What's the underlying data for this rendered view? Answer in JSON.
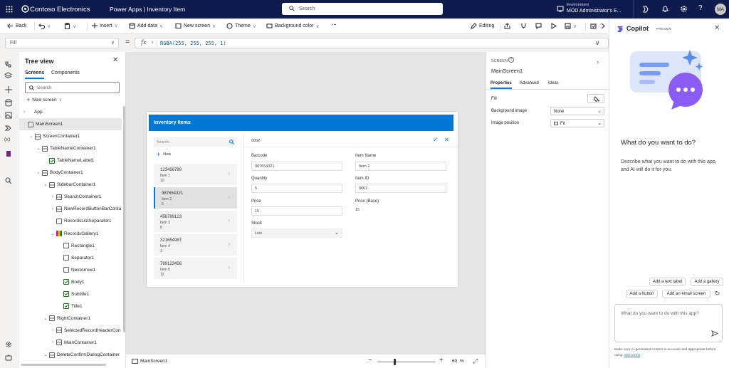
{
  "topbar": {
    "app": "Contoso Electronics",
    "breadcrumb": "Power Apps | Inventory Item",
    "search_placeholder": "Search",
    "env_label": "Environment",
    "env_name": "MOD Administrator's E...",
    "avatar": "MA"
  },
  "command": {
    "back": "Back",
    "insert": "Insert",
    "add_data": "Add data",
    "new_screen": "New screen",
    "theme": "Theme",
    "bg_color": "Background color",
    "more": "···",
    "editing": "Editing"
  },
  "formula": {
    "property": "Fill",
    "fx": "fx",
    "value": "RGBA(255, 255, 255, 1)"
  },
  "tree": {
    "title": "Tree view",
    "tab_screens": "Screens",
    "tab_components": "Components",
    "search_placeholder": "Search",
    "new_screen": "New screen",
    "items": [
      "App",
      "MainScreen1",
      "ScreenContainer1",
      "TableNameContainer1",
      "TableNameLabel1",
      "BodyContainer1",
      "SidebarContainer1",
      "SearchContainer1",
      "NewRecordButtonBarConta",
      "RecordsListSeparator1",
      "RecordsGallery1",
      "Rectangle1",
      "Separator1",
      "NextArrow1",
      "Body1",
      "Subtitle1",
      "Title1",
      "RightContainer1",
      "SelectedRecordHeaderCon",
      "MainContainer1",
      "DeleteConfirmDialogContainer"
    ]
  },
  "app": {
    "header": "Inventory Items",
    "search_placeholder": "Search",
    "new": "New",
    "selected_value": "0002",
    "gallery": [
      {
        "title": "123456789",
        "subtitle": "Item 1",
        "body": "10"
      },
      {
        "title": "987654321",
        "subtitle": "Item 2",
        "body": "5"
      },
      {
        "title": "456789123",
        "subtitle": "Item 3",
        "body": "8"
      },
      {
        "title": "321654987",
        "subtitle": "Item 4",
        "body": "3"
      },
      {
        "title": "789123456",
        "subtitle": "Item 5",
        "body": "12"
      }
    ],
    "form": {
      "barcode_label": "Barcode",
      "barcode": "987654321",
      "item_name_label": "Item Name",
      "item_name": "Item 2",
      "quantity_label": "Quantity",
      "quantity": "5",
      "item_id_label": "Item ID",
      "item_id": "0002",
      "price_label": "Price",
      "price": "15",
      "price_base_label": "Price (Base)",
      "price_base": "15",
      "stock_label": "Stock",
      "stock": "Low"
    }
  },
  "status": {
    "screen": "MainScreen1",
    "zoom": "60",
    "pct": "%"
  },
  "props": {
    "section": "SCREEN",
    "name": "MainScreen1",
    "tab_properties": "Properties",
    "tab_advanced": "Advanced",
    "tab_ideas": "Ideas",
    "fill_label": "Fill",
    "bg_image_label": "Background image",
    "bg_image": "None",
    "img_pos_label": "Image position",
    "img_pos": "Fit"
  },
  "copilot": {
    "title": "Copilot",
    "badge": "PREVIEW",
    "heading": "What do you want to do?",
    "desc": "Describe what you want to do with this app, and AI will do it for you.",
    "chip1": "Add a text label",
    "chip2": "Add a gallery",
    "chip3": "Add a button",
    "chip4": "Add an email screen",
    "input_placeholder": "What do you want to do with this app?",
    "footer": "Make sure AI-generated content is accurate and appropriate before using.",
    "terms": "See terms"
  },
  "colors": {
    "topbar": "#0f1b4c",
    "accent": "#0078d4",
    "brand": "#742774"
  }
}
